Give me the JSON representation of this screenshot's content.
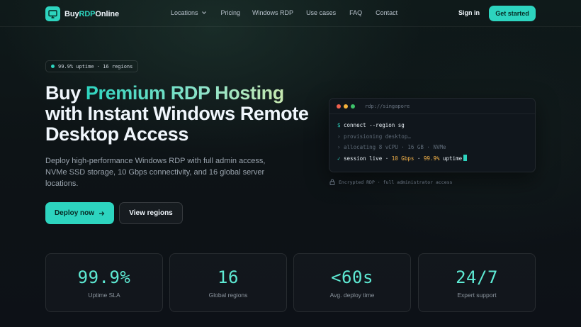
{
  "brand": {
    "name_prefix": "Buy",
    "name_accent": "RDP",
    "name_suffix": "Online"
  },
  "nav": {
    "links": [
      {
        "label": "Locations",
        "has_dropdown": true
      },
      {
        "label": "Pricing"
      },
      {
        "label": "Windows RDP"
      },
      {
        "label": "Use cases"
      },
      {
        "label": "FAQ"
      },
      {
        "label": "Contact"
      }
    ],
    "signin": "Sign in",
    "cta": "Get started"
  },
  "hero": {
    "badge": "99.9% uptime · 16 regions",
    "title_prefix": "Buy ",
    "title_accent": "Premium RDP Hosting",
    "title_rest": " with Instant Windows Remote Desktop Access",
    "subtitle": "Deploy high-performance Windows RDP with full admin access, NVMe SSD storage, 10 Gbps connectivity, and 16 global server locations.",
    "primary_button": "Deploy now",
    "secondary_button": "View regions"
  },
  "terminal": {
    "title": "rdp://singapore",
    "prompt": "$",
    "command": "connect --region sg",
    "line2": "› provisioning desktop…",
    "line3": "› allocating 8 vCPU · 16 GB · NVMe",
    "live_check": "✓",
    "live_text": "session live · ",
    "live_speed": "10 Gbps",
    "live_sep": " · ",
    "live_uptime": "99.9%",
    "live_end": " uptime",
    "note": "Encrypted RDP · full administrator access"
  },
  "stats": [
    {
      "value": "99.9%",
      "label": "Uptime SLA"
    },
    {
      "value": "16",
      "label": "Global regions"
    },
    {
      "value": "<60s",
      "label": "Avg. deploy time"
    },
    {
      "value": "24/7",
      "label": "Expert support"
    }
  ],
  "colors": {
    "accent": "#2dd4bf",
    "background": "#0d1117",
    "highlight": "#f6b44a"
  }
}
